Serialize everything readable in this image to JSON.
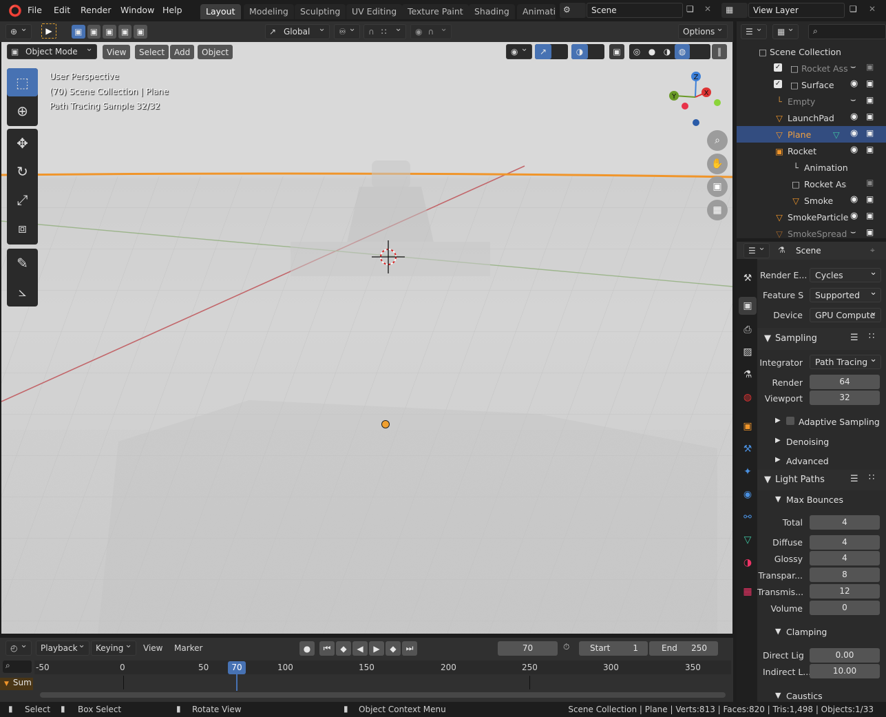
{
  "topbar": {
    "menus": [
      "File",
      "Edit",
      "Render",
      "Window",
      "Help"
    ],
    "workspaces": [
      "Layout",
      "Modeling",
      "Sculpting",
      "UV Editing",
      "Texture Paint",
      "Shading",
      "Animati"
    ],
    "scene": "Scene",
    "view_layer": "View Layer"
  },
  "header": {
    "transform_orientation": "Global",
    "options": "Options",
    "mode": "Object Mode",
    "menus": [
      "View",
      "Select",
      "Add",
      "Object"
    ]
  },
  "viewport": {
    "overlay_lines": [
      "User Perspective",
      "(70) Scene Collection | Plane",
      "Path Tracing Sample 32/32"
    ],
    "gizmo": {
      "z": "Z",
      "x": "X",
      "y": "Y"
    }
  },
  "outliner": {
    "root": "Scene Collection",
    "items": [
      {
        "label": "Rocket Ass",
        "dim": true,
        "check": true
      },
      {
        "label": "Surface",
        "dim": false,
        "check": true
      },
      {
        "label": "Empty",
        "dim": true
      },
      {
        "label": "LaunchPad",
        "dim": false
      },
      {
        "label": "Plane",
        "selected": true
      },
      {
        "label": "Rocket",
        "dim": false
      },
      {
        "label": "Animation",
        "dim": false
      },
      {
        "label": "Rocket Ass",
        "dim": false
      },
      {
        "label": "Smoke",
        "dim": false
      },
      {
        "label": "SmokeParticle",
        "dim": false
      },
      {
        "label": "SmokeSpread",
        "dim": true
      }
    ]
  },
  "properties": {
    "context": "Scene",
    "render_engine_label": "Render E...",
    "render_engine": "Cycles",
    "feature_set_label": "Feature S",
    "feature_set": "Supported",
    "device_label": "Device",
    "device": "GPU Compute",
    "sampling": "Sampling",
    "integrator_label": "Integrator",
    "integrator": "Path Tracing",
    "render_label": "Render",
    "render_samples": "64",
    "viewport_label": "Viewport",
    "viewport_samples": "32",
    "adaptive": "Adaptive Sampling",
    "denoising": "Denoising",
    "advanced": "Advanced",
    "light_paths": "Light Paths",
    "max_bounces": "Max Bounces",
    "bounces": [
      {
        "label": "Total",
        "value": "4"
      },
      {
        "label": "Diffuse",
        "value": "4"
      },
      {
        "label": "Glossy",
        "value": "4"
      },
      {
        "label": "Transpar...",
        "value": "8"
      },
      {
        "label": "Transmis...",
        "value": "12"
      },
      {
        "label": "Volume",
        "value": "0"
      }
    ],
    "clamping": "Clamping",
    "direct_label": "Direct Lig",
    "direct_value": "0.00",
    "indirect_label": "Indirect L...",
    "indirect_value": "10.00",
    "caustics": "Caustics"
  },
  "timeline": {
    "menus": [
      "Playback",
      "Keying",
      "View",
      "Marker"
    ],
    "current_frame": "70",
    "start_label": "Start",
    "start": "1",
    "end_label": "End",
    "end": "250",
    "ticks": [
      "-50",
      "0",
      "50",
      "100",
      "150",
      "200",
      "250",
      "300",
      "350"
    ],
    "summary": "Sum"
  },
  "status": {
    "select": "Select",
    "box_select": "Box Select",
    "rotate": "Rotate View",
    "context_menu": "Object Context Menu",
    "stats": "Scene Collection | Plane | Verts:813 | Faces:820 | Tris:1,498 | Objects:1/33"
  }
}
